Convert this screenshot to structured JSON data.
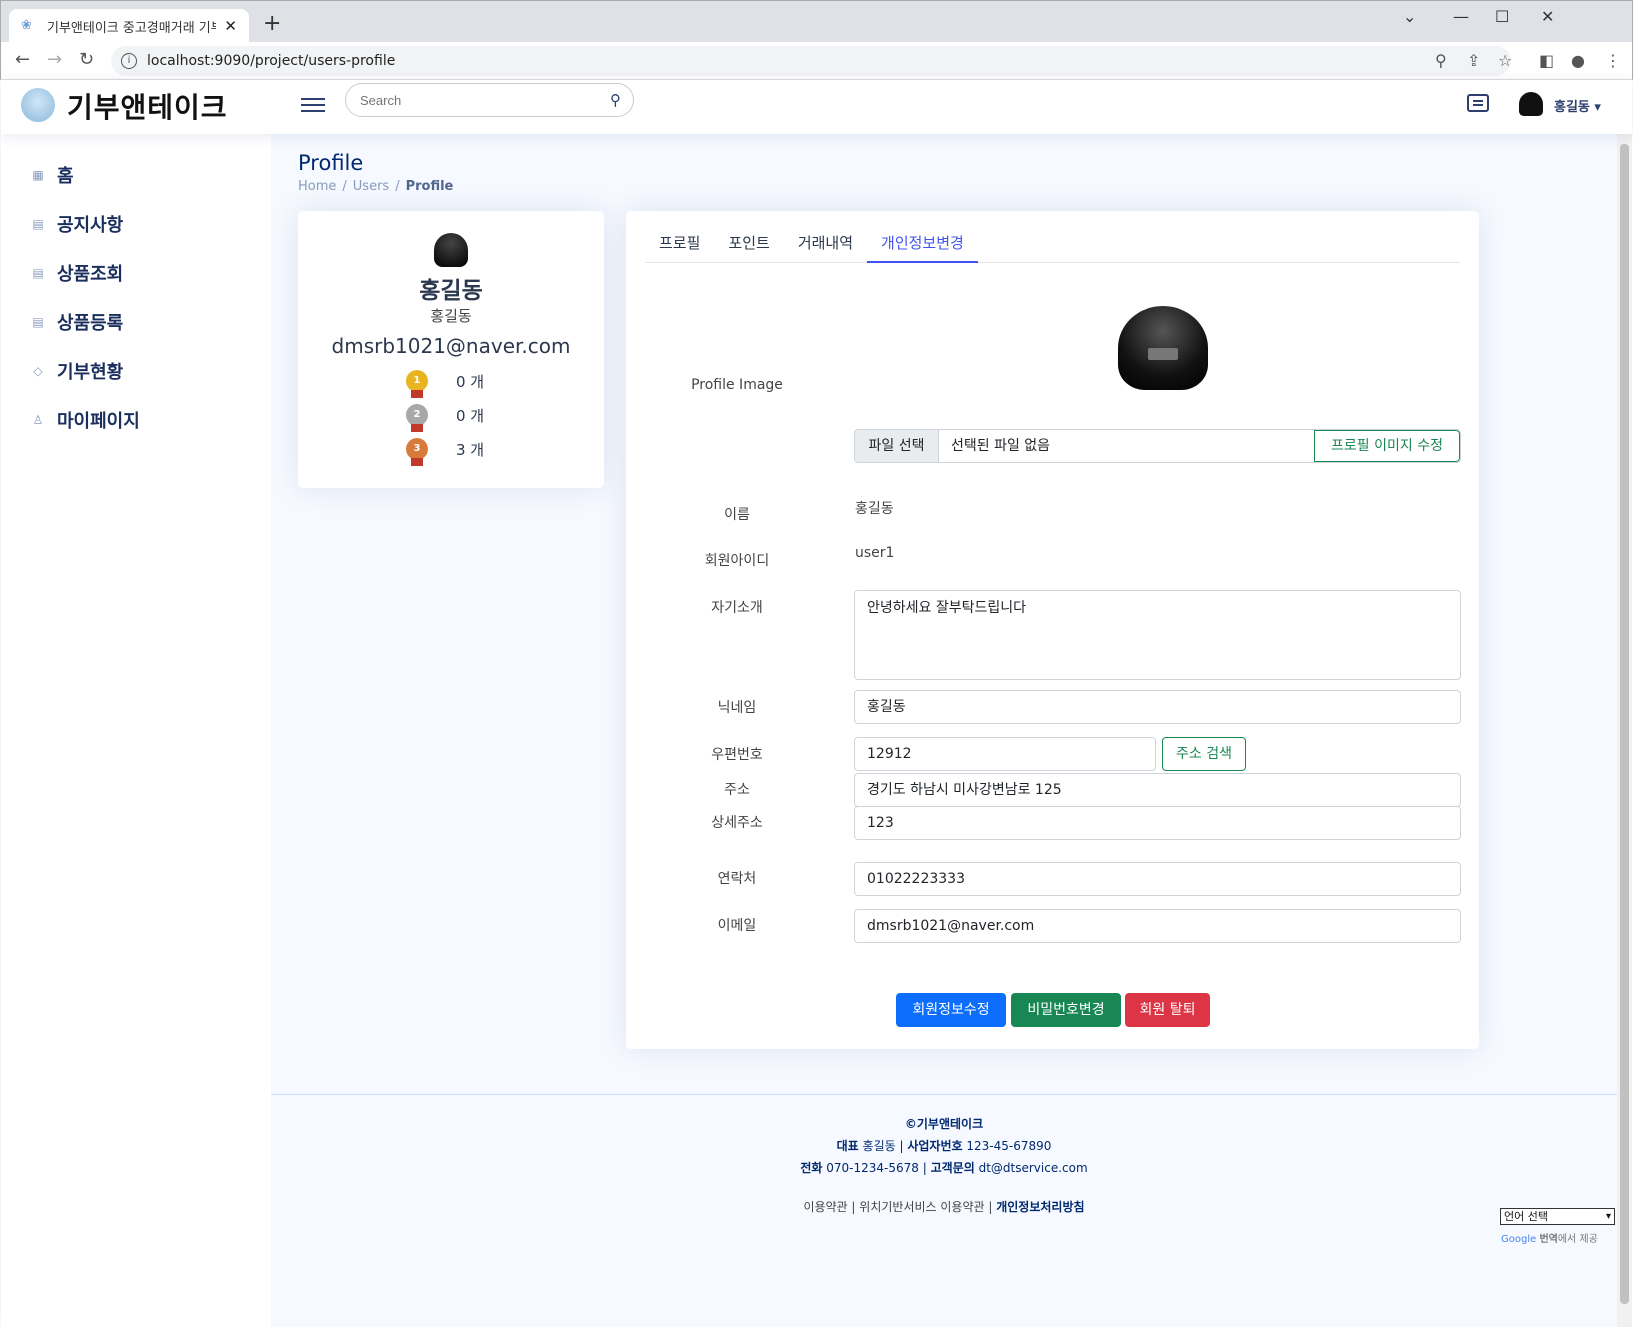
{
  "browser": {
    "tab_title": "기부앤테이크 중고경매거래 기부",
    "url": "localhost:9090/project/users-profile"
  },
  "header": {
    "logo_text": "기부앤테이크",
    "search_placeholder": "Search",
    "user_name": "홍길동"
  },
  "sidebar": {
    "items": [
      {
        "label": "홈",
        "icon": "grid-icon"
      },
      {
        "label": "공지사항",
        "icon": "document-icon"
      },
      {
        "label": "상품조회",
        "icon": "list-icon"
      },
      {
        "label": "상품등록",
        "icon": "list-icon"
      },
      {
        "label": "기부현황",
        "icon": "gem-icon"
      },
      {
        "label": "마이페이지",
        "icon": "person-icon"
      }
    ]
  },
  "page": {
    "title": "Profile",
    "breadcrumb": [
      "Home",
      "Users",
      "Profile"
    ]
  },
  "profile_card": {
    "name": "홍길동",
    "nickname": "홍길동",
    "email": "dmsrb1021@naver.com",
    "medals": [
      {
        "rank": "1",
        "count": "0 개"
      },
      {
        "rank": "2",
        "count": "0 개"
      },
      {
        "rank": "3",
        "count": "3 개"
      }
    ]
  },
  "tabs": [
    "프로필",
    "포인트",
    "거래내역",
    "개인정보변경"
  ],
  "active_tab": "개인정보변경",
  "form": {
    "profile_image_label": "Profile Image",
    "file_button": "파일 선택",
    "file_name": "선택된 파일 없음",
    "edit_image_button": "프로필 이미지 수정",
    "name_label": "이름",
    "name_value": "홍길동",
    "userid_label": "회원아이디",
    "userid_value": "user1",
    "intro_label": "자기소개",
    "intro_value": "안녕하세요 잘부탁드립니다",
    "nickname_label": "닉네임",
    "nickname_value": "홍길동",
    "zipcode_label": "우편번호",
    "zipcode_value": "12912",
    "address_search_button": "주소 검색",
    "address_label": "주소",
    "address_value": "경기도 하남시 미사강변남로 125",
    "detail_address_label": "상세주소",
    "detail_address_value": "123",
    "phone_label": "연락처",
    "phone_value": "01022223333",
    "email_label": "이메일",
    "email_value": "dmsrb1021@naver.com",
    "update_button": "회원정보수정",
    "password_button": "비밀번호변경",
    "withdraw_button": "회원 탈퇴"
  },
  "footer": {
    "copyright": "©기부앤테이크",
    "ceo_label": "대표",
    "ceo": "홍길동",
    "biz_label": "사업자번호",
    "biz_no": "123-45-67890",
    "phone_label": "전화",
    "phone": "070-1234-5678",
    "contact_label": "고객문의",
    "contact": "dt@dtservice.com",
    "terms": "이용약관",
    "location_terms": "위치기반서비스 이용약관",
    "privacy": "개인정보처리방침"
  },
  "translate": {
    "select_label": "언어 선택",
    "google": "Google",
    "bold": "번역",
    "suffix": "에서 제공"
  },
  "colors": {
    "accent": "#4154f1",
    "primary": "#0d6efd",
    "success": "#198754",
    "danger": "#dc3545",
    "sidebar_text": "#1b2f5e"
  }
}
